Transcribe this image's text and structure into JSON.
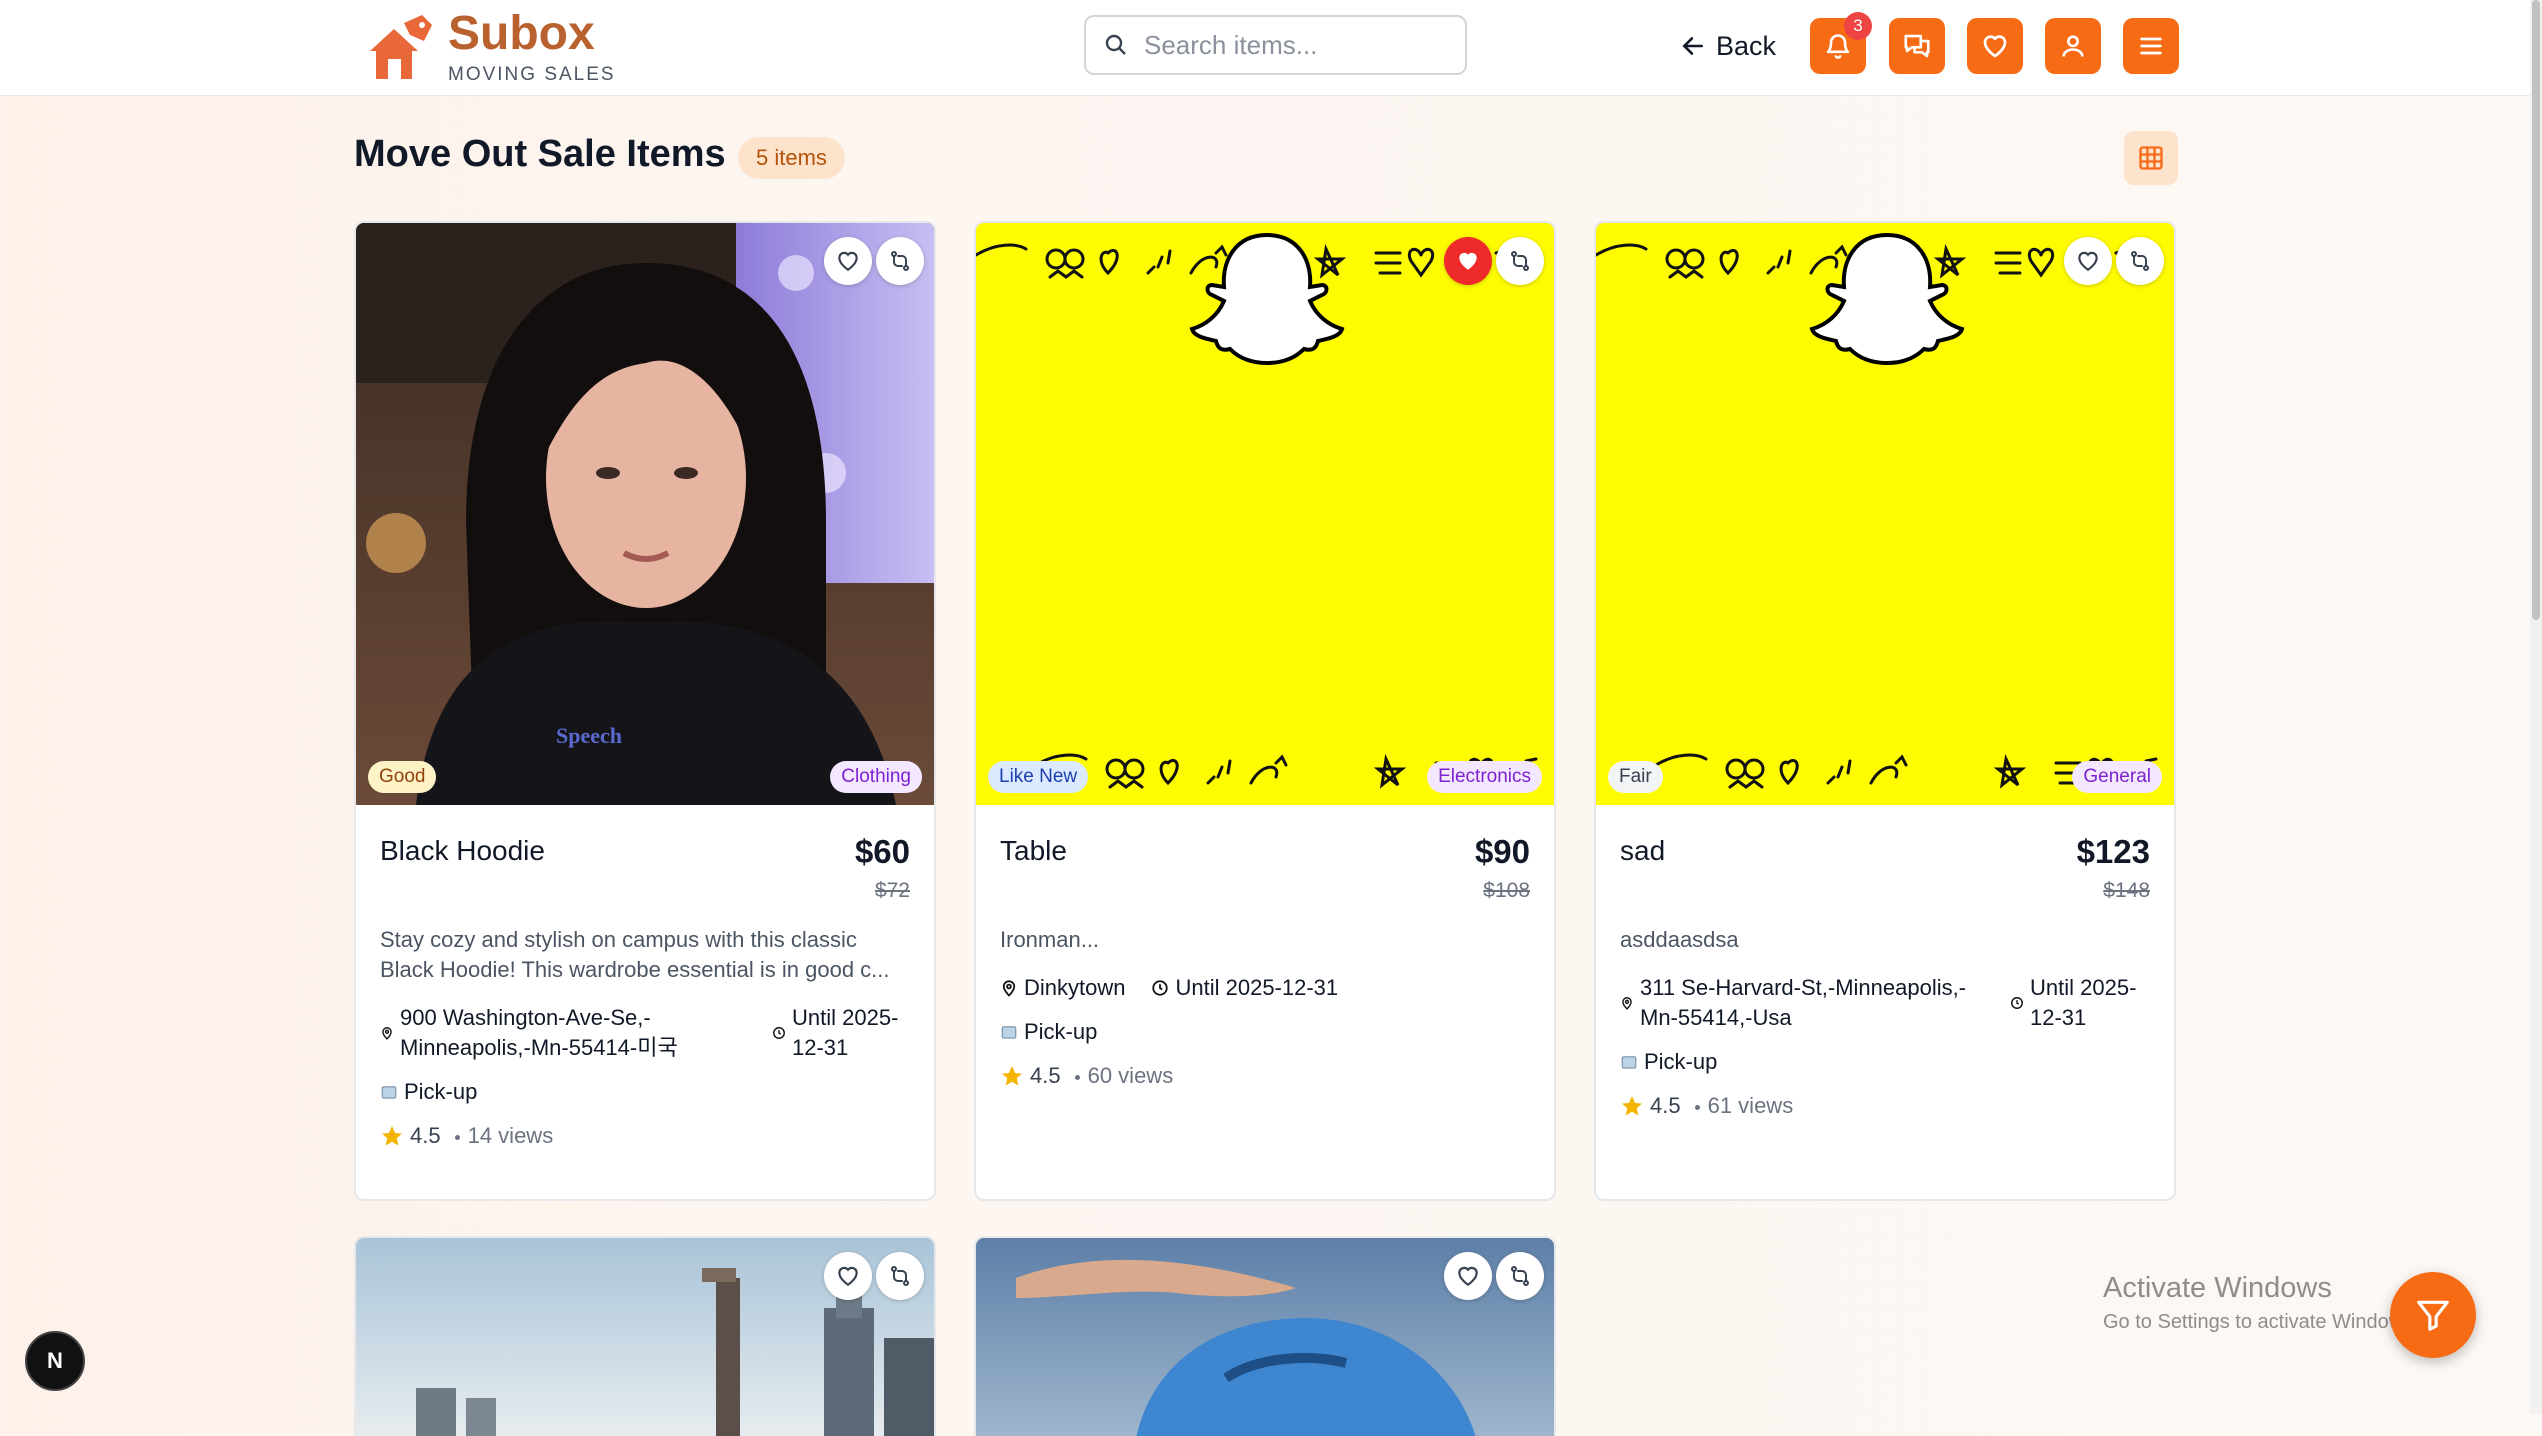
{
  "header": {
    "brand_name": "Subox",
    "brand_sub": "MOVING SALES",
    "search_placeholder": "Search items...",
    "back_label": "Back",
    "notifications_count": "3",
    "icons": [
      "bell-icon",
      "chat-icon",
      "heart-icon",
      "user-icon",
      "menu-icon"
    ]
  },
  "main": {
    "title": "Move Out Sale Items",
    "count_label": "5 items"
  },
  "colors": {
    "accent": "#f76b15",
    "brand": "#b9612f",
    "favorite_active": "#ef2a2a",
    "snap_yellow": "#fffb00"
  },
  "items": [
    {
      "name": "Black Hoodie",
      "price": "$60",
      "original_price": "$72",
      "condition": "Good",
      "category": "Clothing",
      "description": "Stay cozy and stylish on campus with this classic Black Hoodie! This wardrobe essential is in good c...",
      "location": "900 Washington-Ave-Se,-Minneapolis,-Mn-55414-미국",
      "until": "Until 2025-12-31",
      "delivery": "Pick-up",
      "rating": "4.5",
      "views": "14 views",
      "favorited": false,
      "image": "photo of person in black hoodie"
    },
    {
      "name": "Table",
      "price": "$90",
      "original_price": "$108",
      "condition": "Like New",
      "category": "Electronics",
      "description": "Ironman...",
      "location": "Dinkytown",
      "until": "Until 2025-12-31",
      "delivery": "Pick-up",
      "rating": "4.5",
      "views": "60 views",
      "favorited": true,
      "image": "snapchat yellow"
    },
    {
      "name": "sad",
      "price": "$123",
      "original_price": "$148",
      "condition": "Fair",
      "category": "General",
      "description": "asddaasdsa",
      "location": "311 Se-Harvard-St,-Minneapolis,-Mn-55414,-Usa",
      "until": "Until 2025-12-31",
      "delivery": "Pick-up",
      "rating": "4.5",
      "views": "61 views",
      "favorited": false,
      "image": "snapchat yellow"
    }
  ],
  "partial_items": [
    {
      "image": "city skyline"
    },
    {
      "image": "hand over blue helmet"
    }
  ],
  "overlay": {
    "next_badge": "N",
    "windows_line1": "Activate Windows",
    "windows_line2": "Go to Settings to activate Windows."
  }
}
